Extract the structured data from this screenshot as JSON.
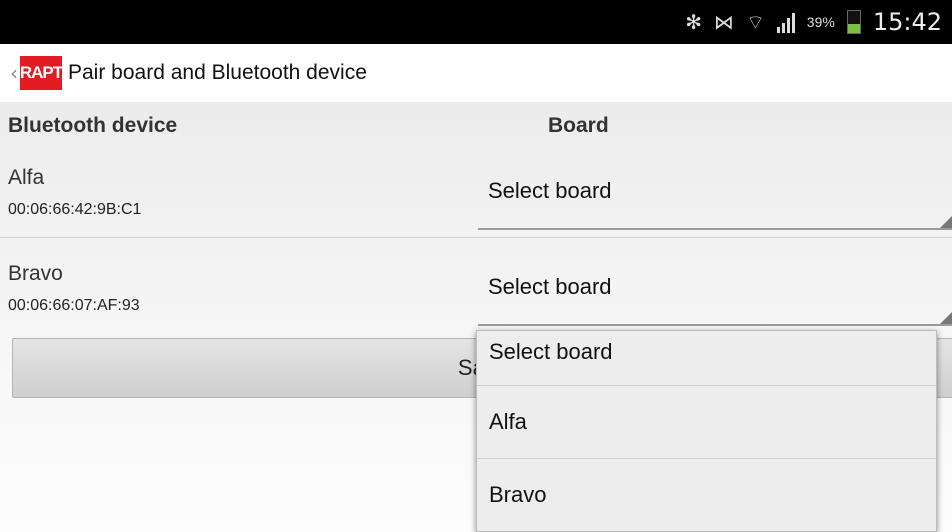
{
  "status_bar": {
    "icons": [
      "bluetooth-icon",
      "mute-icon",
      "wifi-icon",
      "signal-icon"
    ],
    "battery_percent": "39%",
    "battery_level": 0.39,
    "time": "15:42"
  },
  "action_bar": {
    "logo_text": "RAPT",
    "title": "Pair board and Bluetooth device"
  },
  "table": {
    "headers": {
      "device": "Bluetooth device",
      "board": "Board"
    },
    "rows": [
      {
        "name": "Alfa",
        "mac": "00:06:66:42:9B:C1",
        "board": "Select board"
      },
      {
        "name": "Bravo",
        "mac": "00:06:66:07:AF:93",
        "board": "Select board"
      }
    ]
  },
  "save_button": {
    "label": "Save"
  },
  "dropdown": {
    "options": [
      "Select board",
      "Alfa",
      "Bravo"
    ]
  },
  "colors": {
    "brand": "#e51b24",
    "battery": "#7bc142"
  }
}
